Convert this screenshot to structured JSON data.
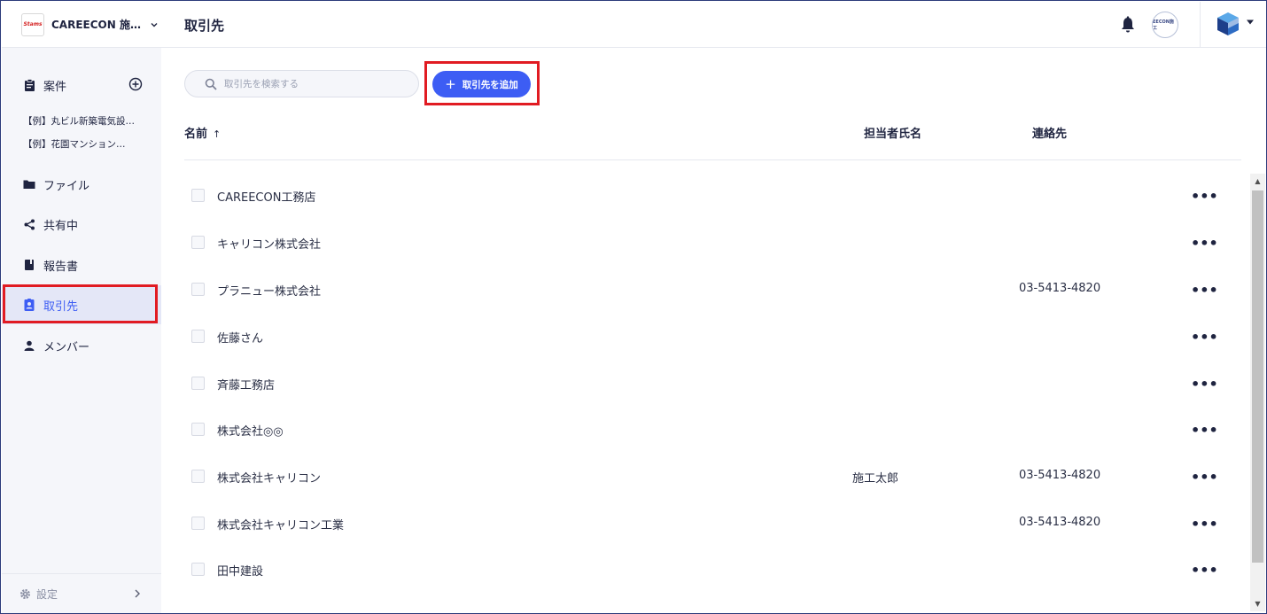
{
  "sidebar": {
    "org_name": "CAREECON 施…",
    "logo_text": "Stams",
    "nav": {
      "projects": "案件",
      "files": "ファイル",
      "shared": "共有中",
      "reports": "報告書",
      "partners": "取引先",
      "members": "メンバー"
    },
    "sub_items": [
      "【例】丸ビル新築電気設…",
      "【例】花園マンション…"
    ],
    "settings": "設定"
  },
  "header": {
    "title": "取引先",
    "company_avatar_text": "EECON施工"
  },
  "toolbar": {
    "search_placeholder": "取引先を検索する",
    "add_label": "取引先を追加"
  },
  "table": {
    "columns": {
      "name": "名前",
      "person": "担当者氏名",
      "contact": "連絡先"
    },
    "rows": [
      {
        "name": "CAREECON工務店",
        "person": "",
        "contact": ""
      },
      {
        "name": "キャリコン株式会社",
        "person": "",
        "contact": ""
      },
      {
        "name": "プラニュー株式会社",
        "person": "",
        "contact": "03-5413-4820"
      },
      {
        "name": "佐藤さん",
        "person": "",
        "contact": ""
      },
      {
        "name": "斉藤工務店",
        "person": "",
        "contact": ""
      },
      {
        "name": "株式会社◎◎",
        "person": "",
        "contact": ""
      },
      {
        "name": "株式会社キャリコン",
        "person": "施工太郎",
        "contact": "03-5413-4820"
      },
      {
        "name": "株式会社キャリコン工業",
        "person": "",
        "contact": "03-5413-4820"
      },
      {
        "name": "田中建設",
        "person": "",
        "contact": ""
      }
    ],
    "more_glyph": "•••"
  },
  "colors": {
    "accent": "#3d5df4",
    "highlight": "#e11b22",
    "active_bg": "#e4e7f7"
  }
}
